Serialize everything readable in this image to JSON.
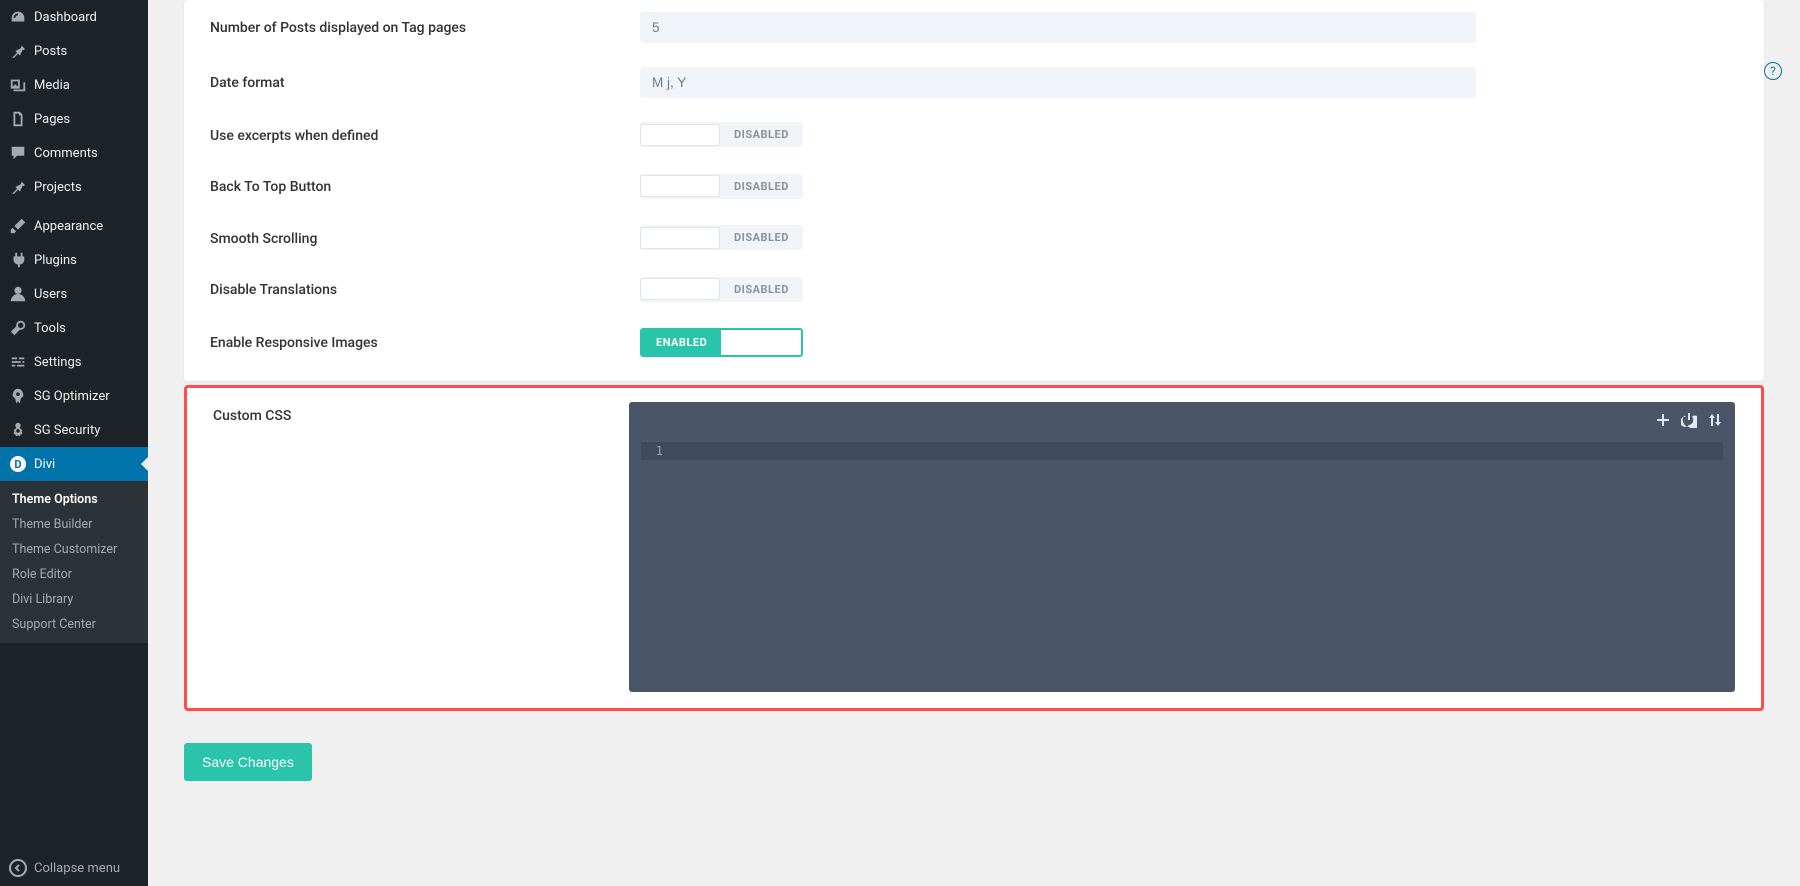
{
  "sidebar": {
    "items": [
      {
        "label": "Dashboard",
        "icon": "gauge"
      },
      {
        "label": "Posts",
        "icon": "pin"
      },
      {
        "label": "Media",
        "icon": "media"
      },
      {
        "label": "Pages",
        "icon": "pages"
      },
      {
        "label": "Comments",
        "icon": "comment"
      },
      {
        "label": "Projects",
        "icon": "pin"
      }
    ],
    "items2": [
      {
        "label": "Appearance",
        "icon": "brush"
      },
      {
        "label": "Plugins",
        "icon": "plug"
      },
      {
        "label": "Users",
        "icon": "user"
      },
      {
        "label": "Tools",
        "icon": "wrench"
      },
      {
        "label": "Settings",
        "icon": "sliders"
      },
      {
        "label": "SG Optimizer",
        "icon": "rocket"
      },
      {
        "label": "SG Security",
        "icon": "shield-gear"
      }
    ],
    "divi": {
      "label": "Divi",
      "letter": "D"
    },
    "sub": [
      {
        "label": "Theme Options",
        "current": true
      },
      {
        "label": "Theme Builder"
      },
      {
        "label": "Theme Customizer"
      },
      {
        "label": "Role Editor"
      },
      {
        "label": "Divi Library"
      },
      {
        "label": "Support Center"
      }
    ],
    "collapse": "Collapse menu"
  },
  "settings": {
    "posts_tag_label": "Number of Posts displayed on Tag pages",
    "posts_tag_value": "5",
    "date_format_label": "Date format",
    "date_format_value": "M j, Y",
    "excerpts_label": "Use excerpts when defined",
    "back_top_label": "Back To Top Button",
    "smooth_label": "Smooth Scrolling",
    "translations_label": "Disable Translations",
    "responsive_label": "Enable Responsive Images",
    "disabled_text": "DISABLED",
    "enabled_text": "ENABLED",
    "custom_css_label": "Custom CSS",
    "line_number": "1"
  },
  "save_button": "Save Changes",
  "help": "?"
}
